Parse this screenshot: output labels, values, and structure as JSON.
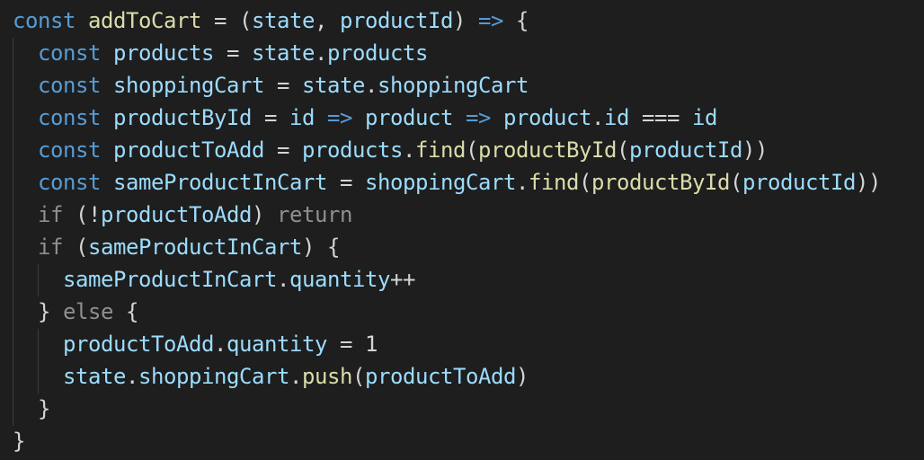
{
  "editor": {
    "colors": {
      "background": "#1e1e1e",
      "keyword": "#569cd6",
      "control": "#8f8f8f",
      "variable": "#9cdcfe",
      "function": "#dcdcaa",
      "plain": "#d4d4d4",
      "indent_guide": "#3b3b3b"
    },
    "lines": [
      [
        [
          "kw",
          "const"
        ],
        [
          "ws",
          " "
        ],
        [
          "fn",
          "addToCart"
        ],
        [
          "op",
          " = "
        ],
        [
          "pun",
          "("
        ],
        [
          "var",
          "state"
        ],
        [
          "pun",
          ", "
        ],
        [
          "var",
          "productId"
        ],
        [
          "pun",
          ") "
        ],
        [
          "arrow",
          "=>"
        ],
        [
          "pun",
          " {"
        ]
      ],
      [
        [
          "ws",
          "  "
        ],
        [
          "kw",
          "const"
        ],
        [
          "ws",
          " "
        ],
        [
          "var",
          "products"
        ],
        [
          "op",
          " = "
        ],
        [
          "var",
          "state"
        ],
        [
          "pun",
          "."
        ],
        [
          "var",
          "products"
        ]
      ],
      [
        [
          "ws",
          "  "
        ],
        [
          "kw",
          "const"
        ],
        [
          "ws",
          " "
        ],
        [
          "var",
          "shoppingCart"
        ],
        [
          "op",
          " = "
        ],
        [
          "var",
          "state"
        ],
        [
          "pun",
          "."
        ],
        [
          "var",
          "shoppingCart"
        ]
      ],
      [
        [
          "ws",
          "  "
        ],
        [
          "kw",
          "const"
        ],
        [
          "ws",
          " "
        ],
        [
          "var",
          "productById"
        ],
        [
          "op",
          " = "
        ],
        [
          "var",
          "id"
        ],
        [
          "ws",
          " "
        ],
        [
          "arrow",
          "=>"
        ],
        [
          "ws",
          " "
        ],
        [
          "var",
          "product"
        ],
        [
          "ws",
          " "
        ],
        [
          "arrow",
          "=>"
        ],
        [
          "ws",
          " "
        ],
        [
          "var",
          "product"
        ],
        [
          "pun",
          "."
        ],
        [
          "var",
          "id"
        ],
        [
          "op",
          " === "
        ],
        [
          "var",
          "id"
        ]
      ],
      [
        [
          "ws",
          "  "
        ],
        [
          "kw",
          "const"
        ],
        [
          "ws",
          " "
        ],
        [
          "var",
          "productToAdd"
        ],
        [
          "op",
          " = "
        ],
        [
          "var",
          "products"
        ],
        [
          "pun",
          "."
        ],
        [
          "fn",
          "find"
        ],
        [
          "pun",
          "("
        ],
        [
          "fn",
          "productById"
        ],
        [
          "pun",
          "("
        ],
        [
          "var",
          "productId"
        ],
        [
          "pun",
          "))"
        ]
      ],
      [
        [
          "ws",
          "  "
        ],
        [
          "kw",
          "const"
        ],
        [
          "ws",
          " "
        ],
        [
          "var",
          "sameProductInCart"
        ],
        [
          "op",
          " = "
        ],
        [
          "var",
          "shoppingCart"
        ],
        [
          "pun",
          "."
        ],
        [
          "fn",
          "find"
        ],
        [
          "pun",
          "("
        ],
        [
          "fn",
          "productById"
        ],
        [
          "pun",
          "("
        ],
        [
          "var",
          "productId"
        ],
        [
          "pun",
          "))"
        ]
      ],
      [
        [
          "ws",
          "  "
        ],
        [
          "ctl",
          "if"
        ],
        [
          "pun",
          " (!"
        ],
        [
          "var",
          "productToAdd"
        ],
        [
          "pun",
          ") "
        ],
        [
          "ctl",
          "return"
        ]
      ],
      [
        [
          "ws",
          "  "
        ],
        [
          "ctl",
          "if"
        ],
        [
          "pun",
          " ("
        ],
        [
          "var",
          "sameProductInCart"
        ],
        [
          "pun",
          ") {"
        ]
      ],
      [
        [
          "ws",
          "    "
        ],
        [
          "var",
          "sameProductInCart"
        ],
        [
          "pun",
          "."
        ],
        [
          "var",
          "quantity"
        ],
        [
          "op",
          "++"
        ]
      ],
      [
        [
          "ws",
          "  "
        ],
        [
          "pun",
          "} "
        ],
        [
          "ctl",
          "else"
        ],
        [
          "pun",
          " {"
        ]
      ],
      [
        [
          "ws",
          "    "
        ],
        [
          "var",
          "productToAdd"
        ],
        [
          "pun",
          "."
        ],
        [
          "var",
          "quantity"
        ],
        [
          "op",
          " = "
        ],
        [
          "num",
          "1"
        ]
      ],
      [
        [
          "ws",
          "    "
        ],
        [
          "var",
          "state"
        ],
        [
          "pun",
          "."
        ],
        [
          "var",
          "shoppingCart"
        ],
        [
          "pun",
          "."
        ],
        [
          "fn",
          "push"
        ],
        [
          "pun",
          "("
        ],
        [
          "var",
          "productToAdd"
        ],
        [
          "pun",
          ")"
        ]
      ],
      [
        [
          "ws",
          "  "
        ],
        [
          "pun",
          "}"
        ]
      ],
      [
        [
          "pun",
          "}"
        ]
      ]
    ]
  }
}
